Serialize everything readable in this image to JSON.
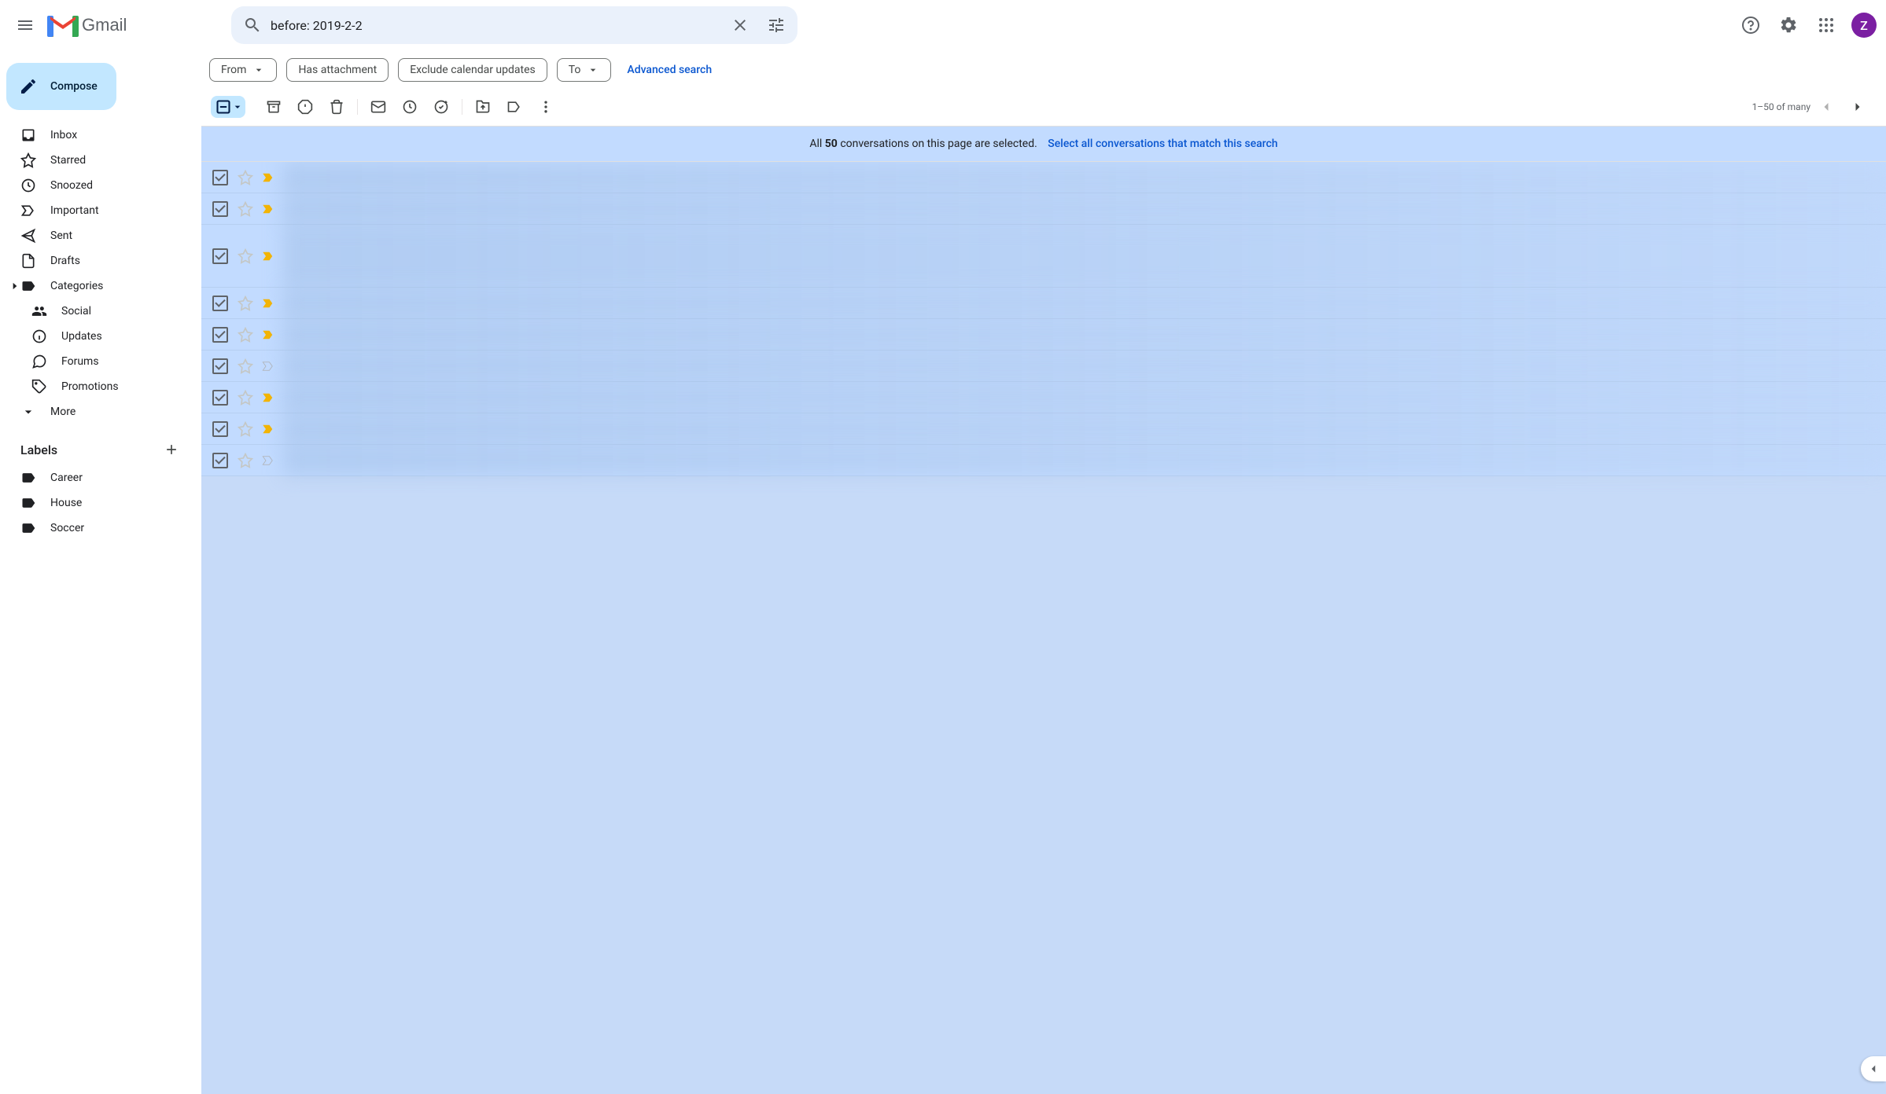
{
  "header": {
    "gmail_text": "Gmail",
    "avatar_initial": "Z"
  },
  "search": {
    "value": "before: 2019-2-2"
  },
  "filters": {
    "from": "From",
    "has_attachment": "Has attachment",
    "exclude_cal": "Exclude calendar updates",
    "to": "To",
    "advanced": "Advanced search"
  },
  "toolbar": {
    "page_count": "1–50 of many"
  },
  "banner": {
    "pre": "All ",
    "count": "50",
    "post": " conversations on this page are selected.",
    "link": "Select all conversations that match this search"
  },
  "sidebar": {
    "compose": "Compose",
    "inbox": "Inbox",
    "starred": "Starred",
    "snoozed": "Snoozed",
    "important": "Important",
    "sent": "Sent",
    "drafts": "Drafts",
    "categories": "Categories",
    "social": "Social",
    "updates": "Updates",
    "forums": "Forums",
    "promotions": "Promotions",
    "more": "More",
    "labels_header": "Labels",
    "labels": [
      "Career",
      "House",
      "Soccer"
    ]
  },
  "rows": [
    {
      "important": true
    },
    {
      "important": true
    },
    {
      "important": true,
      "tall": true
    },
    {
      "important": true
    },
    {
      "important": true
    },
    {
      "important": false
    },
    {
      "important": true
    },
    {
      "important": true
    },
    {
      "important": false
    }
  ]
}
